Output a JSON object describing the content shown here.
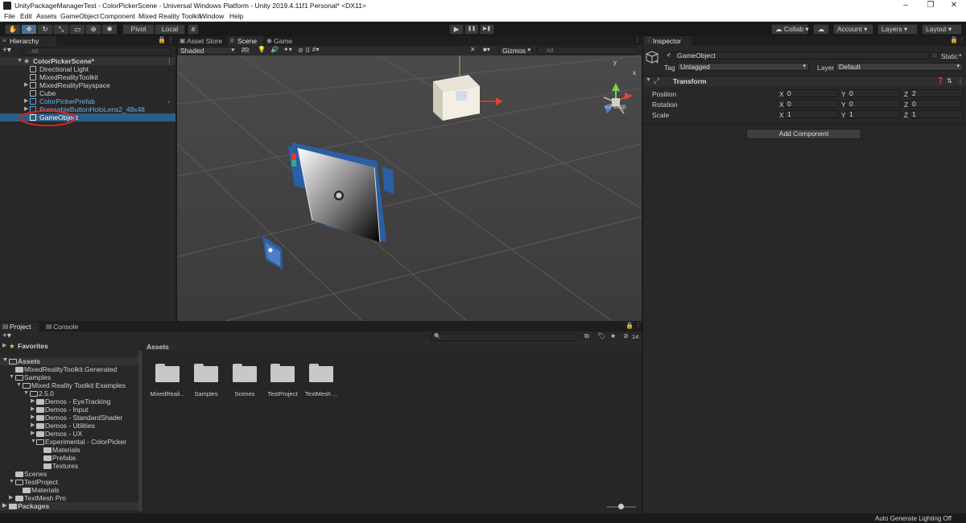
{
  "window": {
    "title": "UnityPackageManagerTest - ColorPickerScene - Universal Windows Platform - Unity 2019.4.11f1 Personal* <DX11>",
    "minimize": "–",
    "restore": "❐",
    "close": "✕"
  },
  "menu": [
    "File",
    "Edit",
    "Assets",
    "GameObject",
    "Component",
    "Mixed Reality Toolkit",
    "Window",
    "Help"
  ],
  "toolbar": {
    "pivot": "Pivot",
    "local": "Local",
    "play": "▶",
    "pause": "❚❚",
    "step": "▶❚",
    "collab": "Collab",
    "account": "Account",
    "layers": "Layers",
    "layout": "Layout"
  },
  "hierarchy": {
    "tab": "Hierarchy",
    "search_placeholder": "All",
    "scene": "ColorPickerScene*",
    "items": [
      {
        "label": "Directional Light"
      },
      {
        "label": "MixedRealityToolkit"
      },
      {
        "label": "MixedRealityPlayspace"
      },
      {
        "label": "Cube"
      },
      {
        "label": "ColorPickerPrefab"
      },
      {
        "label": "PressableButtonHoloLens2_48x48"
      },
      {
        "label": "GameObject"
      }
    ]
  },
  "scene": {
    "tabs": [
      "Asset Store",
      "Scene",
      "Game"
    ],
    "shading": "Shaded",
    "mode2d": "2D",
    "hidden_count": "0",
    "gizmos": "Gizmos",
    "search_placeholder": "All",
    "persp": "Persp",
    "gizmo_y": "y",
    "gizmo_x": "x"
  },
  "inspector": {
    "tab": "Inspector",
    "object_name": "GameObject",
    "static": "Static",
    "tag_label": "Tag",
    "tag_value": "Untagged",
    "layer_label": "Layer",
    "layer_value": "Default",
    "component": "Transform",
    "rows": [
      {
        "label": "Position",
        "x": "0",
        "y": "0",
        "z": "2"
      },
      {
        "label": "Rotation",
        "x": "0",
        "y": "0",
        "z": "0"
      },
      {
        "label": "Scale",
        "x": "1",
        "y": "1",
        "z": "1"
      }
    ],
    "axis_x": "X",
    "axis_y": "Y",
    "axis_z": "Z",
    "add_component": "Add Component"
  },
  "project": {
    "tabs": [
      "Project",
      "Console"
    ],
    "favorites": "Favorites",
    "assets_root": "Assets",
    "hidden_count": "14",
    "tree": [
      {
        "label": "MixedRealityToolkit.Generated"
      },
      {
        "label": "Samples"
      },
      {
        "label": "Mixed Reality Toolkit Examples"
      },
      {
        "label": "2.5.0"
      },
      {
        "label": "Demos - EyeTracking"
      },
      {
        "label": "Demos - Input"
      },
      {
        "label": "Demos - StandardShader"
      },
      {
        "label": "Demos - Utilities"
      },
      {
        "label": "Demos - UX"
      },
      {
        "label": "Experimental - ColorPicker"
      },
      {
        "label": "Materials"
      },
      {
        "label": "Prefabs"
      },
      {
        "label": "Textures"
      },
      {
        "label": "Scenes"
      },
      {
        "label": "TestProject"
      },
      {
        "label": "Materials"
      },
      {
        "label": "TextMesh Pro"
      },
      {
        "label": "Packages"
      }
    ],
    "breadcrumb": "Assets",
    "folders": [
      "MixedReali...",
      "Samples",
      "Scenes",
      "TestProject",
      "TextMesh ..."
    ]
  },
  "status": "Auto Generate Lighting Off"
}
